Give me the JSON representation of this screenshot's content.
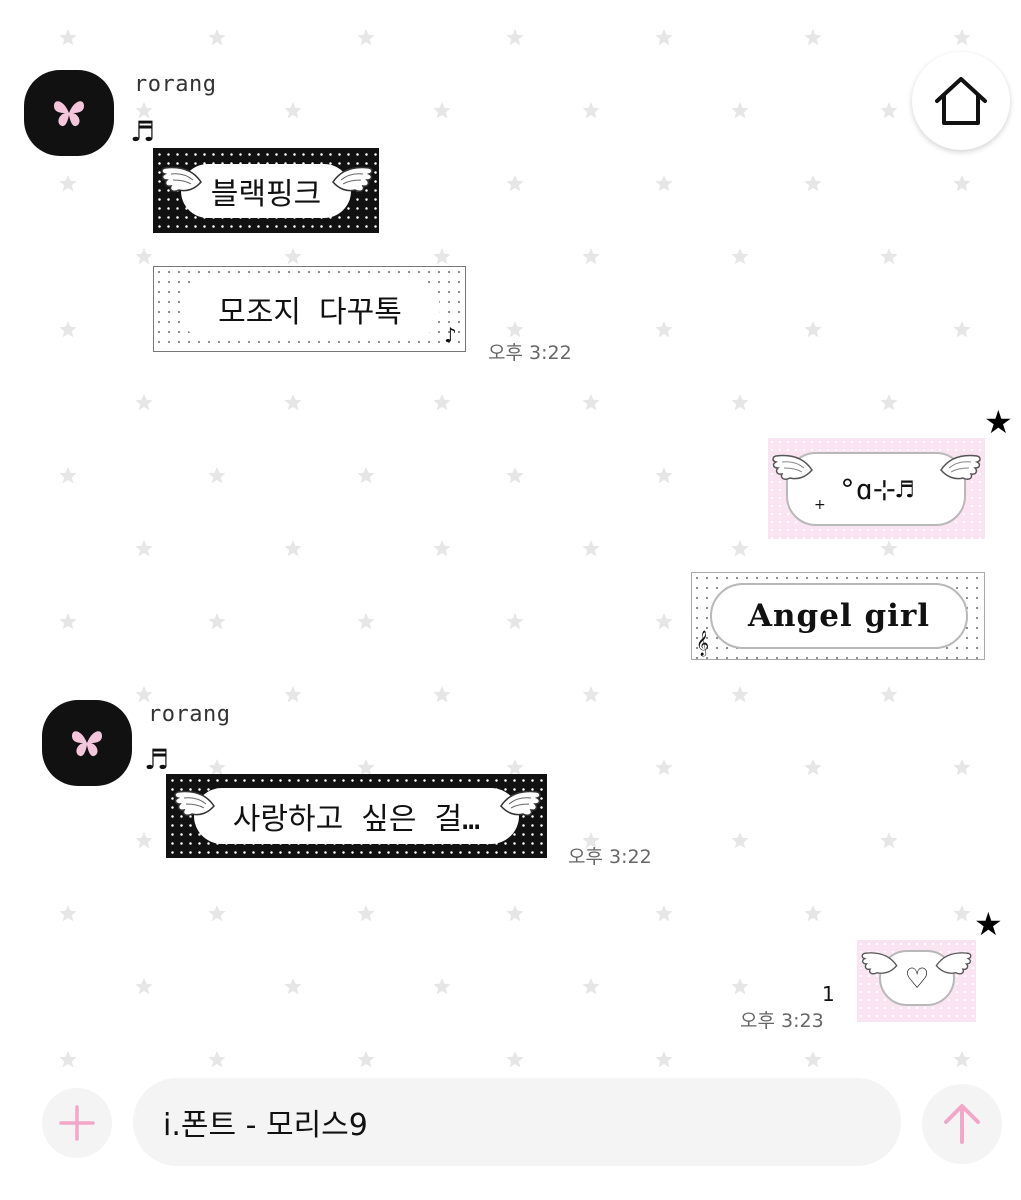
{
  "colors": {
    "background": "#ffffff",
    "star_pattern": "#e6e6e6",
    "accent_pink": "#f2a6c8",
    "bubble_black": "#111111",
    "bubble_pink": "#fbe4f1"
  },
  "header": {
    "home_icon": "home-icon"
  },
  "messages": [
    {
      "side": "left",
      "sender": "rorang",
      "avatar_icon": "butterfly-icon",
      "tag_icon": "music-note-icon",
      "tag_glyph": "♬",
      "bubbles": [
        {
          "style": "black-winged",
          "text": "블랙핑크"
        },
        {
          "style": "white-dotted",
          "text": "모조지 다꾸톡",
          "corner_glyph": "♪"
        }
      ],
      "time": "오후 3:22"
    },
    {
      "side": "right",
      "status_icon": "star-icon",
      "status_glyph": "★",
      "bubbles": [
        {
          "style": "pink-winged",
          "text": "°ɑ⊹♬",
          "prefix_glyph": "+"
        },
        {
          "style": "white-dotted",
          "text": "Angel girl",
          "corner_glyph": "𝄞"
        }
      ]
    },
    {
      "side": "left",
      "sender": "rorang",
      "avatar_icon": "butterfly-icon",
      "tag_icon": "music-note-icon",
      "tag_glyph": "♬",
      "bubbles": [
        {
          "style": "black-winged",
          "text": "사랑하고 싶은 걸…"
        }
      ],
      "time": "오후 3:22"
    },
    {
      "side": "right",
      "status_icon": "star-icon",
      "status_glyph": "★",
      "bubbles": [
        {
          "style": "pink-winged",
          "text": "♡"
        }
      ],
      "unread": "1",
      "time": "오후 3:23"
    }
  ],
  "composer": {
    "add_icon": "plus-icon",
    "input_value": "i.폰트 - 모리스9",
    "send_icon": "arrow-up-icon"
  }
}
